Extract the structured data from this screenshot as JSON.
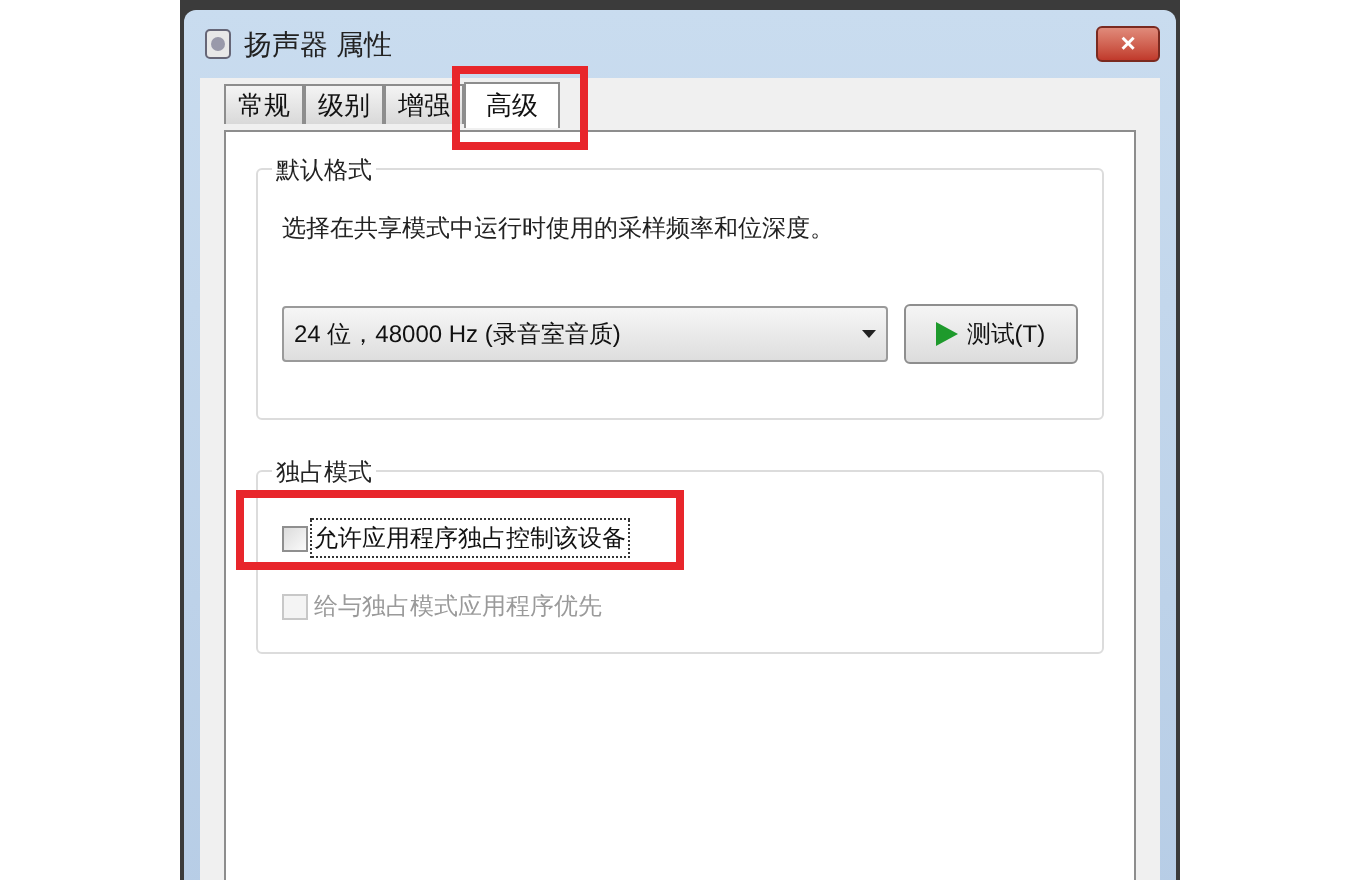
{
  "window": {
    "title": "扬声器 属性",
    "close": "×"
  },
  "tabs": [
    {
      "label": "常规",
      "selected": false
    },
    {
      "label": "级别",
      "selected": false
    },
    {
      "label": "增强",
      "selected": false
    },
    {
      "label": "高级",
      "selected": true,
      "highlighted": true
    }
  ],
  "default_format": {
    "legend": "默认格式",
    "description": "选择在共享模式中运行时使用的采样频率和位深度。",
    "format_select": {
      "value": "24 位，48000 Hz (录音室音质)"
    },
    "test_button": "测试(T)"
  },
  "exclusive_mode": {
    "legend": "独占模式",
    "options": [
      {
        "label": "允许应用程序独占控制该设备",
        "checked": false,
        "disabled": false,
        "focused": true,
        "highlighted": true
      },
      {
        "label": "给与独占模式应用程序优先",
        "checked": false,
        "disabled": true,
        "focused": false,
        "highlighted": false
      }
    ]
  }
}
